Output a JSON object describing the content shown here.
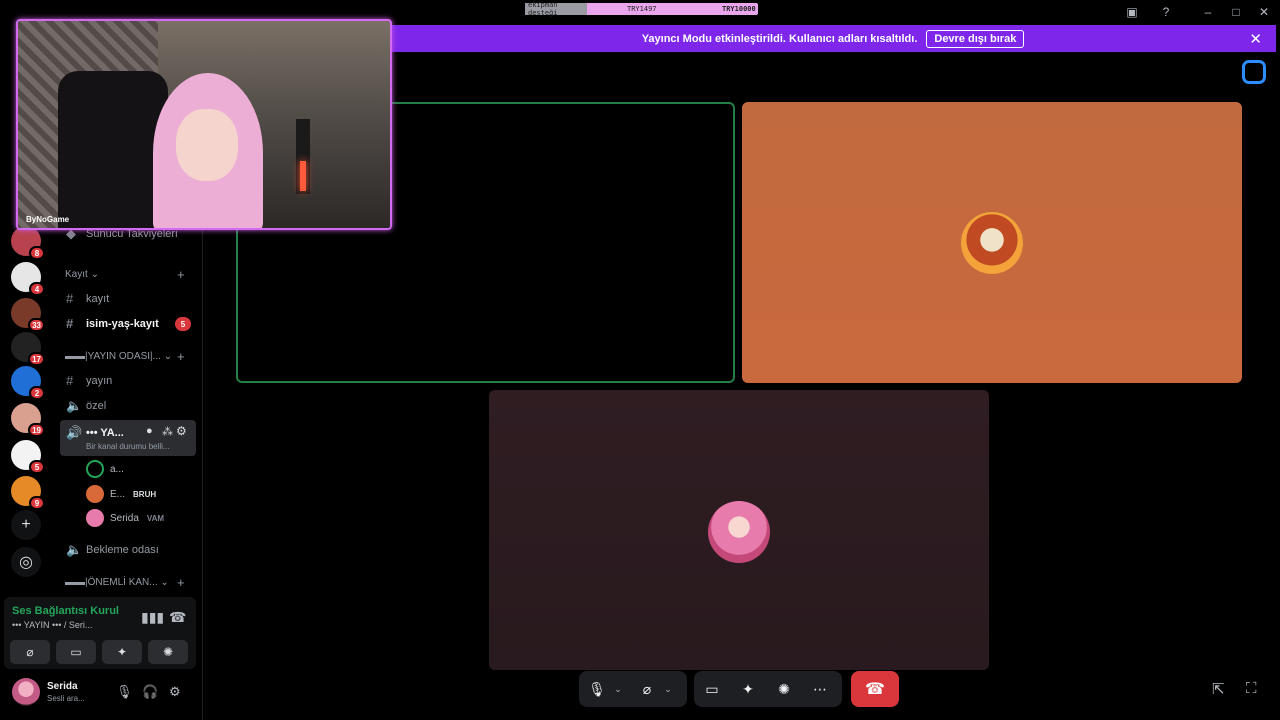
{
  "donation_bar": {
    "label": "ekipman desteği",
    "current": "TRY1497",
    "goal": "TRY10000"
  },
  "titlebar": {
    "icons": [
      "inbox-icon",
      "help-icon",
      "minimize-icon",
      "maximize-icon",
      "close-icon"
    ]
  },
  "banner": {
    "message": "Yayıncı Modu etkinleştirildi. Kullanıcı adları kısaltıldı.",
    "button": "Devre dışı bırak",
    "color": "#7e27ea"
  },
  "webcam": {
    "logo": "ByNoGame"
  },
  "servers": [
    {
      "badge": "8",
      "color": "#b8434e"
    },
    {
      "badge": "4",
      "color": "#e6e6e6"
    },
    {
      "badge": "33",
      "color": "#7a3a2a"
    },
    {
      "badge": "17",
      "color": "#222222"
    },
    {
      "badge": "2",
      "color": "#1f6fd6"
    },
    {
      "badge": "19",
      "color": "#d44"
    },
    {
      "badge": "5",
      "color": "#f3f3f3"
    },
    {
      "badge": "9",
      "color": "#e58a26"
    }
  ],
  "sidebar": {
    "boosts": "Sunucu Takviyeleri",
    "category_kayit": "Kayıt",
    "channels": {
      "kayit": "kayıt",
      "isim_yas_kayit": "isim-yaş-kayıt",
      "isim_yas_kayit_badge": "5",
      "category_yayin": "▬▬|YAYIN ODASI|...",
      "yayin": "yayın",
      "ozel": "özel",
      "active_voice": "••• YA...",
      "active_voice_status": "Bir kanal durumu belli...",
      "bekleme": "Bekleme odası",
      "category_onemli": "▬▬|ÖNEMLİ KAN..."
    },
    "voice_users": [
      {
        "name": "a...",
        "tag": ""
      },
      {
        "name": "E...",
        "tag": "BRUH"
      },
      {
        "name": "Serida",
        "tag": "VAM"
      }
    ]
  },
  "voice_panel": {
    "status": "Ses Bağlantısı Kurul",
    "channel": "••• YAYIN ••• / Seri...",
    "status_color": "#23a55a"
  },
  "user_panel": {
    "name": "Serida",
    "status": "Sesli ara..."
  },
  "call_controls": {
    "hangup_color": "#da373c",
    "icons": [
      "microphone-icon",
      "camera-off-icon",
      "screen-share-icon",
      "activities-icon",
      "soundboard-icon",
      "more-icon",
      "hangup-icon"
    ]
  }
}
